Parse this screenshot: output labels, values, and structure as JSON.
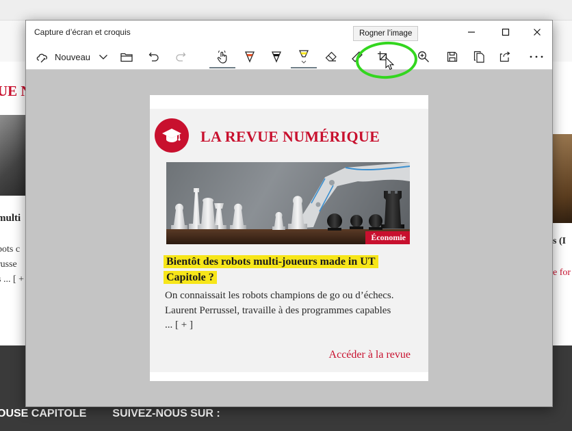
{
  "background_site": {
    "left_title": "UE N",
    "left_headline": "multi",
    "left_lines": [
      "bots c",
      "russe",
      "s ... [ +"
    ],
    "right_headline": "s (I",
    "right_link": "e for",
    "footer_items": [
      "OUSE CAPITOLE",
      "SUIVEZ-NOUS SUR :"
    ]
  },
  "window": {
    "title": "Capture d’écran et croquis",
    "controls": {
      "minimize_icon": "minimize-icon",
      "maximize_icon": "maximize-icon",
      "close_icon": "close-icon"
    }
  },
  "toolbar": {
    "new_label": "Nouveau",
    "tooltip": "Rogner l’image",
    "tools": [
      "new-snip-icon",
      "chevron-down-icon",
      "folder-icon",
      "undo-icon",
      "redo-icon",
      "touch-writing-icon",
      "ballpoint-pen-icon",
      "pencil-icon",
      "highlighter-icon",
      "eraser-icon",
      "ruler-icon",
      "crop-icon",
      "zoom-icon",
      "save-icon",
      "copy-icon",
      "share-icon",
      "more-icon"
    ]
  },
  "capture": {
    "revue_title": "LA REVUE NUMÉRIQUE",
    "category": "Économie",
    "headline_line1": "Bientôt des robots multi-joueurs made in UT",
    "headline_line2": "Capitole ?",
    "excerpt": "On connaissait les robots champions de go ou d’échecs. Laurent Perrussel, travaille à des programmes capables ... [ + ]",
    "read_more": "Accéder à la revue"
  },
  "colors": {
    "brand_red": "#c8102e",
    "highlight_yellow": "#f7e619",
    "annotation_green": "#33d61f",
    "canvas_gray": "#c4c4c4"
  }
}
